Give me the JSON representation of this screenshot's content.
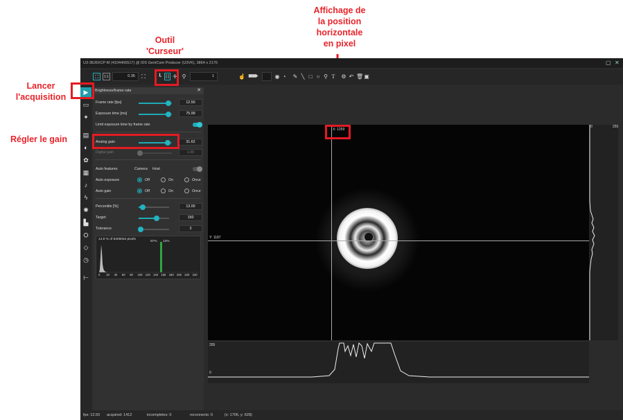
{
  "annotations": {
    "start": "Lancer\nl'acquisition",
    "gain": "Régler le gain",
    "cursor": "Outil\n'Curseur'",
    "position": "Affichage de\nla position\nhorizontale\nen pixel"
  },
  "window": {
    "title": "U3-38J6XCP-M (4104406517) @ IDS GenICam Producer (U3VK), 3864 x 2176",
    "accent": "#1fb0be"
  },
  "toolbar": {
    "zoom_value": "0.35",
    "zoom_field2": "1",
    "one_to_one": "1:1"
  },
  "panel": {
    "title": "Brightness/frame rate",
    "frame_rate": {
      "label": "Frame rate [fps]",
      "value": "12.50",
      "level": 0.9
    },
    "exposure": {
      "label": "Exposure time [ms]",
      "value": "75.99",
      "level": 0.9
    },
    "limit_exposure": {
      "label": "Limit exposure time by frame rate"
    },
    "analog_gain": {
      "label": "Analog gain",
      "value": "31.62",
      "level": 0.88
    },
    "digital_gain": {
      "label": "Digital gain",
      "value": "1.00",
      "level": 0.05
    },
    "auto_features": {
      "label": "Auto features",
      "camera": "Camera",
      "host": "Host"
    },
    "auto_exposure": {
      "label": "Auto exposure",
      "off": "Off",
      "on": "On",
      "once": "Once"
    },
    "auto_gain": {
      "label": "Auto gain",
      "off": "Off",
      "on": "On",
      "once": "Once"
    },
    "percentile": {
      "label": "Percentile [%]",
      "value": "13.00",
      "level": 0.13
    },
    "target": {
      "label": "Target",
      "value": "150",
      "level": 0.59
    },
    "tolerance": {
      "label": "Tolerance",
      "value": "3",
      "level": 0.06
    },
    "histogram": {
      "caption": "14.8 % of 8408064 pixels",
      "pct_left": "87%",
      "pct_right": "13%",
      "ticks": [
        "0",
        "20",
        "40",
        "60",
        "80",
        "100",
        "120",
        "140",
        "160",
        "180",
        "200",
        "220",
        "240"
      ]
    }
  },
  "viewer": {
    "cursor_x_label": "X: 1259",
    "cursor_y_label": "Y: 1187",
    "vprofile_min": "0",
    "vprofile_max": "255",
    "hprofile_max": "255",
    "hprofile_min": "0"
  },
  "statusbar": {
    "fps": "fps: 12.50",
    "acquired": "acquired: 1412",
    "incompletes": "incompletes: 0",
    "reconnects": "reconnects: 0",
    "coords": "(x: 1706, y: 628)"
  }
}
